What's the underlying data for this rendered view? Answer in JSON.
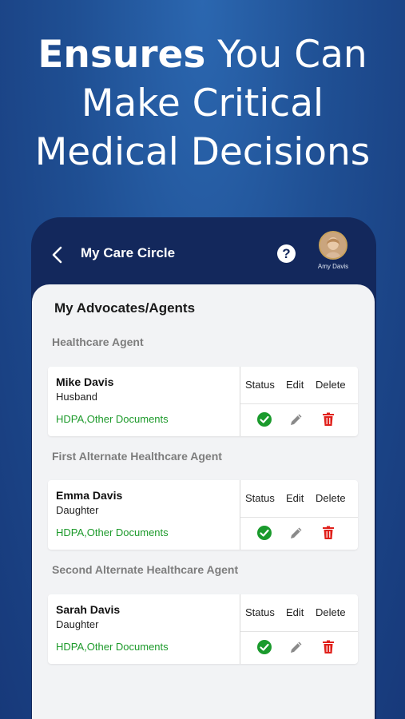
{
  "headline": {
    "bold_word": "Ensures",
    "rest_line1": " You Can",
    "line2": "Make Critical",
    "line3": "Medical Decisions"
  },
  "header": {
    "title": "My Care Circle",
    "help": "?",
    "user_name": "Amy Davis"
  },
  "main": {
    "section_title": "My Advocates/Agents",
    "columns": {
      "status": "Status",
      "edit": "Edit",
      "delete": "Delete"
    },
    "groups": [
      {
        "label": "Healthcare Agent",
        "agent": {
          "name": "Mike  Davis",
          "relation": "Husband",
          "documents": "HDPA,Other Documents"
        }
      },
      {
        "label": "First Alternate Healthcare Agent",
        "agent": {
          "name": "Emma Davis",
          "relation": "Daughter",
          "documents": "HDPA,Other Documents"
        }
      },
      {
        "label": "Second Alternate Healthcare Agent",
        "agent": {
          "name": "Sarah Davis",
          "relation": "Daughter",
          "documents": "HDPA,Other Documents"
        }
      }
    ]
  },
  "colors": {
    "status_ok": "#1a9a2c",
    "delete": "#e0201b",
    "edit": "#8a8a8a",
    "documents_link": "#1d9a2b"
  },
  "icons": [
    "back-arrow",
    "help-circle",
    "check-circle",
    "pencil",
    "trash"
  ]
}
